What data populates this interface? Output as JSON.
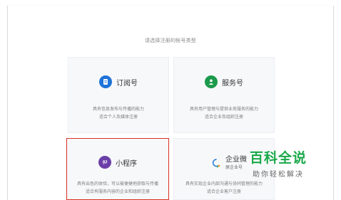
{
  "prompt": "请选择注册的帐号类型",
  "cards": [
    {
      "title": "订阅号",
      "icon": "document-icon",
      "color": "#1e73d9",
      "desc1": "具有信息发布与传播的能力",
      "desc2": "适合个人及媒体注册"
    },
    {
      "title": "服务号",
      "icon": "user-icon",
      "color": "#1b9a4b",
      "desc1": "具有用户管理与提供业务服务的能力",
      "desc2": "适合企业及组织注册"
    },
    {
      "title": "小程序",
      "icon": "miniprogram-icon",
      "color": "#6b3fa8",
      "desc1": "具有出色的体验，可以被便捷地获取与传播",
      "desc2": "适合有服务内容的企业和组织注册"
    },
    {
      "title": "企业微",
      "subtitle": "原企业号",
      "icon": "enterprise-wechat-icon",
      "color": "#2b7fd6",
      "desc1": "具有实现企业内部沟通与协同管理的能力",
      "desc2": "适合企业客户注册"
    }
  ],
  "watermark": {
    "title": "百科全说",
    "subtitle": "助你轻松解决"
  }
}
